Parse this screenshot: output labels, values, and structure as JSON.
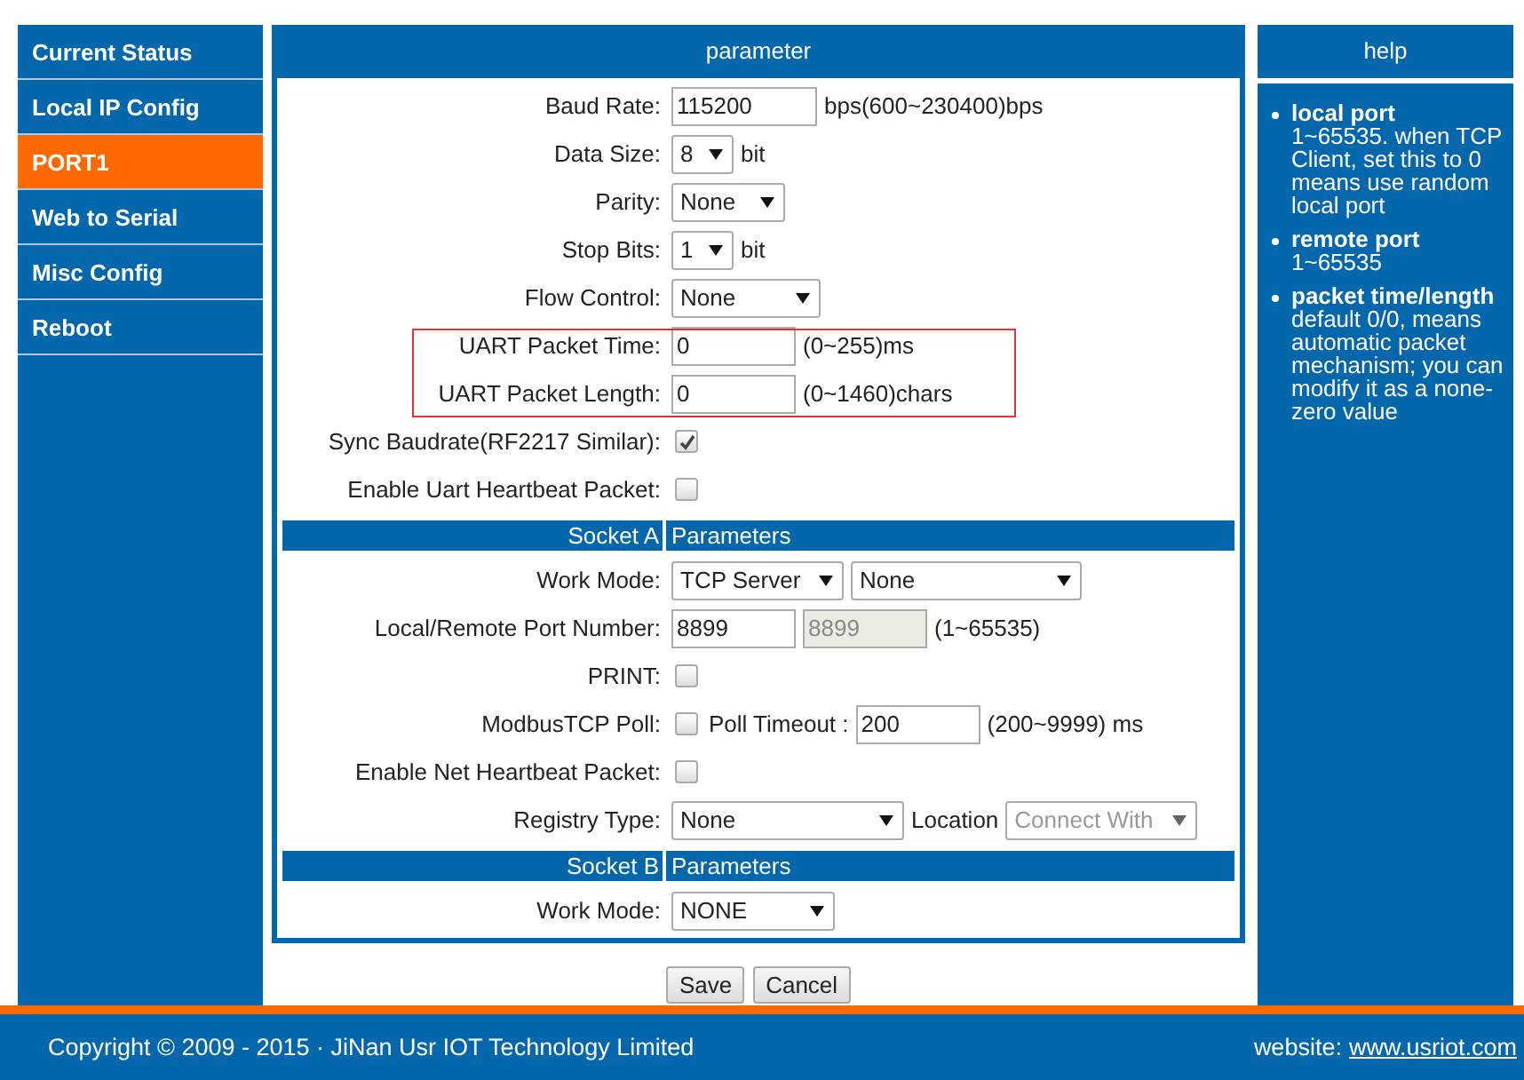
{
  "sidebar": {
    "items": [
      {
        "label": "Current Status",
        "selected": false
      },
      {
        "label": "Local IP Config",
        "selected": false
      },
      {
        "label": "PORT1",
        "selected": true
      },
      {
        "label": "Web to Serial",
        "selected": false
      },
      {
        "label": "Misc Config",
        "selected": false
      },
      {
        "label": "Reboot",
        "selected": false
      }
    ]
  },
  "parameter_panel": {
    "title": "parameter",
    "rows": [
      {
        "kind": "field",
        "label": "Baud Rate:",
        "controls": [
          {
            "kind": "input",
            "value": "115200",
            "disabled": false
          },
          {
            "kind": "text",
            "text": "bps(600~230400)bps"
          }
        ]
      },
      {
        "kind": "field",
        "label": "Data Size:",
        "controls": [
          {
            "kind": "select",
            "value": "8",
            "disabled": false
          },
          {
            "kind": "text",
            "text": "bit"
          }
        ]
      },
      {
        "kind": "field",
        "label": "Parity:",
        "controls": [
          {
            "kind": "select",
            "value": "None",
            "disabled": false
          }
        ]
      },
      {
        "kind": "field",
        "label": "Stop Bits:",
        "controls": [
          {
            "kind": "select",
            "value": "1",
            "disabled": false
          },
          {
            "kind": "text",
            "text": "bit"
          }
        ]
      },
      {
        "kind": "field",
        "label": "Flow Control:",
        "controls": [
          {
            "kind": "select",
            "value": "None",
            "disabled": false
          }
        ]
      },
      {
        "kind": "group",
        "outlined": true,
        "rows": [
          {
            "kind": "field",
            "label": "UART Packet Time:",
            "controls": [
              {
                "kind": "input",
                "value": "0",
                "disabled": false
              },
              {
                "kind": "text",
                "text": "(0~255)ms"
              }
            ]
          },
          {
            "kind": "field",
            "label": "UART Packet Length:",
            "controls": [
              {
                "kind": "input",
                "value": "0",
                "disabled": false
              },
              {
                "kind": "text",
                "text": "(0~1460)chars"
              }
            ]
          }
        ]
      },
      {
        "kind": "field",
        "label": "Sync Baudrate(RF2217 Similar):",
        "controls": [
          {
            "kind": "checkbox",
            "checked": true
          }
        ]
      },
      {
        "kind": "field",
        "label": "Enable Uart Heartbeat Packet:",
        "controls": [
          {
            "kind": "checkbox",
            "checked": false
          }
        ]
      },
      {
        "kind": "section",
        "left": "Socket A",
        "right": "Parameters"
      },
      {
        "kind": "field",
        "label": "Work Mode:",
        "controls": [
          {
            "kind": "select",
            "value": "TCP Server",
            "disabled": false
          },
          {
            "kind": "select",
            "value": "None",
            "disabled": false
          }
        ]
      },
      {
        "kind": "field",
        "label": "Local/Remote Port Number:",
        "controls": [
          {
            "kind": "input",
            "value": "8899",
            "disabled": false
          },
          {
            "kind": "input",
            "value": "8899",
            "disabled": true
          },
          {
            "kind": "text",
            "text": "(1~65535)"
          }
        ]
      },
      {
        "kind": "field",
        "label": "PRINT:",
        "controls": [
          {
            "kind": "checkbox",
            "checked": false
          }
        ]
      },
      {
        "kind": "field",
        "label": "ModbusTCP Poll:",
        "controls": [
          {
            "kind": "checkbox",
            "checked": false
          },
          {
            "kind": "text",
            "text": "Poll Timeout :"
          },
          {
            "kind": "input",
            "value": "200",
            "disabled": false
          },
          {
            "kind": "text",
            "text": "(200~9999) ms"
          }
        ]
      },
      {
        "kind": "field",
        "label": "Enable Net Heartbeat Packet:",
        "controls": [
          {
            "kind": "checkbox",
            "checked": false
          }
        ]
      },
      {
        "kind": "field",
        "label": "Registry Type:",
        "controls": [
          {
            "kind": "select",
            "value": "None",
            "disabled": false
          },
          {
            "kind": "text",
            "text": "Location"
          },
          {
            "kind": "select",
            "value": "Connect With",
            "disabled": true
          }
        ]
      },
      {
        "kind": "section",
        "left": "Socket B",
        "right": "Parameters"
      },
      {
        "kind": "field",
        "label": "Work Mode:",
        "controls": [
          {
            "kind": "select",
            "value": "NONE",
            "disabled": false
          }
        ]
      }
    ]
  },
  "buttons": [
    "Save",
    "Cancel"
  ],
  "help_panel": {
    "title": "help",
    "items": [
      "**local port** 1~65535. when TCP Client, set this to 0 means use random local port",
      "**remote port** 1~65535",
      "**packet time/length** default 0/0, means automatic packet mechanism; you can modify it as a none-zero value"
    ]
  },
  "footer": {
    "copyright": "Copyright © 2009 - 2015 · JiNan Usr IOT Technology Limited",
    "website_label": "website:",
    "website_link": "www.usriot.com"
  }
}
